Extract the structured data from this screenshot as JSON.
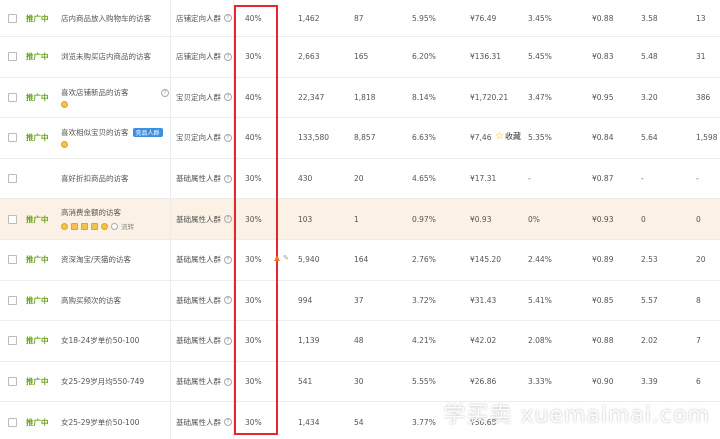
{
  "rows": [
    {
      "status": "推广中",
      "name": "店内商品放入购物车的访客",
      "crowd": "店铺定向人群",
      "ratio": "40%",
      "c1": "1,462",
      "c2": "87",
      "c3": "5.95%",
      "c4": "¥76.49",
      "c5": "3.45%",
      "c6": "¥0.88",
      "c7": "3.58",
      "c8": "13"
    },
    {
      "status": "推广中",
      "name": "浏览未购买店内商品的访客",
      "crowd": "店铺定向人群",
      "ratio": "30%",
      "c1": "2,663",
      "c2": "165",
      "c3": "6.20%",
      "c4": "¥136.31",
      "c5": "5.45%",
      "c6": "¥0.83",
      "c7": "5.48",
      "c8": "31"
    },
    {
      "status": "推广中",
      "name": "喜欢店铺新品的访客",
      "crowd": "宝贝定向人群",
      "ratio": "40%",
      "c1": "22,347",
      "c2": "1,818",
      "c3": "8.14%",
      "c4": "¥1,720.21",
      "c5": "3.47%",
      "c6": "¥0.95",
      "c7": "3.20",
      "c8": "386"
    },
    {
      "status": "推广中",
      "name": "喜欢相似宝贝的访客",
      "tag": "竞品人群",
      "crowd": "宝贝定向人群",
      "ratio": "40%",
      "c1": "133,580",
      "c2": "8,857",
      "c3": "6.63%",
      "c4": "¥7,46",
      "c5": "5.35%",
      "c6": "¥0.84",
      "c7": "5.64",
      "c8": "1,598"
    },
    {
      "status": "",
      "name": "喜好折扣商品的访客",
      "crowd": "基础属性人群",
      "ratio": "30%",
      "c1": "430",
      "c2": "20",
      "c3": "4.65%",
      "c4": "¥17.31",
      "c5": "-",
      "c6": "¥0.87",
      "c7": "-",
      "c8": "-"
    },
    {
      "status": "推广中",
      "name": "高消费金额的访客",
      "extra": "流转",
      "crowd": "基础属性人群",
      "ratio": "30%",
      "c1": "103",
      "c2": "1",
      "c3": "0.97%",
      "c4": "¥0.93",
      "c5": "0%",
      "c6": "¥0.93",
      "c7": "0",
      "c8": "0"
    },
    {
      "status": "推广中",
      "name": "资深淘宝/天猫的访客",
      "crowd": "基础属性人群",
      "ratio": "30%",
      "c1": "5,940",
      "c2": "164",
      "c3": "2.76%",
      "c4": "¥145.20",
      "c5": "2.44%",
      "c6": "¥0.89",
      "c7": "2.53",
      "c8": "20"
    },
    {
      "status": "推广中",
      "name": "高购买频次的访客",
      "crowd": "基础属性人群",
      "ratio": "30%",
      "c1": "994",
      "c2": "37",
      "c3": "3.72%",
      "c4": "¥31.43",
      "c5": "5.41%",
      "c6": "¥0.85",
      "c7": "5.57",
      "c8": "8"
    },
    {
      "status": "推广中",
      "name": "女18-24岁单价50-100",
      "crowd": "基础属性人群",
      "ratio": "30%",
      "c1": "1,139",
      "c2": "48",
      "c3": "4.21%",
      "c4": "¥42.02",
      "c5": "2.08%",
      "c6": "¥0.88",
      "c7": "2.02",
      "c8": "7"
    },
    {
      "status": "推广中",
      "name": "女25-29岁月均550-749",
      "crowd": "基础属性人群",
      "ratio": "30%",
      "c1": "541",
      "c2": "30",
      "c3": "5.55%",
      "c4": "¥26.86",
      "c5": "3.33%",
      "c6": "¥0.90",
      "c7": "3.39",
      "c8": "6"
    },
    {
      "status": "推广中",
      "name": "女25-29岁单价50-100",
      "crowd": "基础属性人群",
      "ratio": "30%",
      "c1": "1,434",
      "c2": "54",
      "c3": "3.77%",
      "c4": "¥50.68",
      "c5": "",
      "c6": "",
      "c7": "",
      "c8": ""
    }
  ],
  "popup": {
    "favorite_label": "收藏"
  },
  "watermark": "学买卖 xuemaimai.com"
}
